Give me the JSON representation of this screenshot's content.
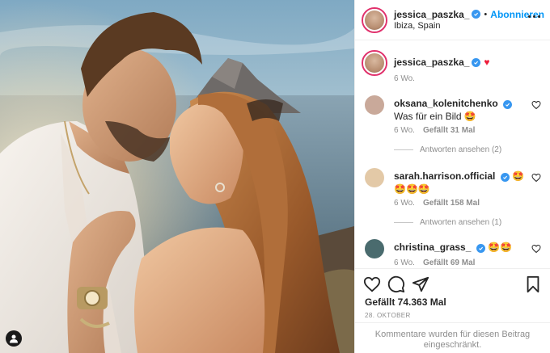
{
  "post": {
    "author": "jessica_paszka_",
    "follow_label": "Abonnieren",
    "separator": "•",
    "location": "Ibiza, Spain",
    "caption_emoji": "♥",
    "caption_time": "6 Wo.",
    "likes_text": "Gefällt 74.363 Mal",
    "date": "28. OKTOBER",
    "comments_disabled": "Kommentare wurden für diesen Beitrag eingeschränkt."
  },
  "comments": [
    {
      "user": "oksana_kolenitchenko",
      "text": "Was für ein Bild 🤩",
      "time": "6 Wo.",
      "likes": "Gefällt 31 Mal",
      "replies": "Antworten ansehen (2)",
      "avatar_color": "#c9a99a"
    },
    {
      "user": "sarah.harrison.official",
      "text": "🤩🤩🤩🤩",
      "time": "6 Wo.",
      "likes": "Gefällt 158 Mal",
      "replies": "Antworten ansehen (1)",
      "avatar_color": "#e3c9a7"
    },
    {
      "user": "christina_grass_",
      "text": "🤩🤩",
      "time": "6 Wo.",
      "likes": "Gefällt 69 Mal",
      "replies": "",
      "avatar_color": "#4a6b6e"
    }
  ],
  "icons": {
    "tag": "person-tag-icon",
    "like": "heart-outline-icon",
    "comment": "comment-bubble-icon",
    "share": "paper-plane-icon",
    "save": "bookmark-icon",
    "more": "more-options-icon",
    "verified": "verified-badge-icon"
  },
  "colors": {
    "accent": "#0095f6",
    "verified": "#3897f0",
    "heart": "#ed1c3a",
    "muted": "#8e8e8e"
  }
}
